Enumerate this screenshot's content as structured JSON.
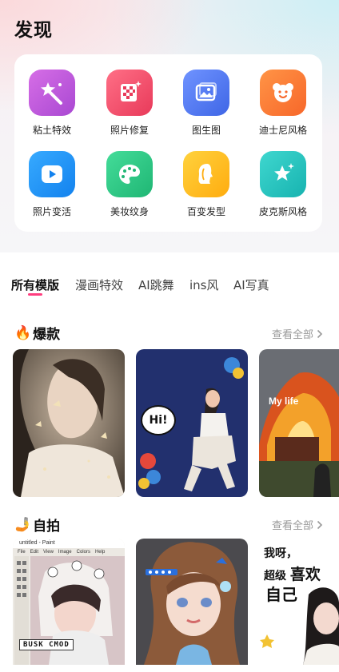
{
  "page": {
    "title": "发现"
  },
  "tools": [
    {
      "label": "粘土特效",
      "icon": "magic-wand-star-icon",
      "color": "#c45bdc"
    },
    {
      "label": "照片修复",
      "icon": "photo-grid-sparkle-icon",
      "color": "#f2506b"
    },
    {
      "label": "图生图",
      "icon": "image-icon",
      "color": "#4f78f0"
    },
    {
      "label": "迪士尼风格",
      "icon": "bear-face-icon",
      "color": "#ff7c3c"
    },
    {
      "label": "照片变活",
      "icon": "play-icon",
      "color": "#2596f5"
    },
    {
      "label": "美妆纹身",
      "icon": "palette-icon",
      "color": "#2fcf8a"
    },
    {
      "label": "百变发型",
      "icon": "hair-profile-icon",
      "color": "#ffc21f"
    },
    {
      "label": "皮克斯风格",
      "icon": "star-sparkle-icon",
      "color": "#27c6c0"
    }
  ],
  "tabs": [
    "所有模版",
    "漫画特效",
    "AI跳舞",
    "ins风",
    "AI写真"
  ],
  "sections": {
    "hot": {
      "emoji": "🔥",
      "title": "爆款",
      "more": "查看全部"
    },
    "selfie": {
      "emoji": "🤳",
      "title": "自拍",
      "more": "查看全部"
    }
  },
  "cards": {
    "hot2_bubble": "Hi!",
    "hot3_overlay": "My life",
    "selfie1_window": "untitled - Paint",
    "selfie1_menu": [
      "File",
      "Edit",
      "View",
      "Image",
      "Colors",
      "Help"
    ],
    "selfie1_stamp": "BUSK CMOD",
    "selfie3_line1": "我呀，",
    "selfie3_line2": "超级",
    "selfie3_line3": "喜欢",
    "selfie3_line4": "自己"
  }
}
